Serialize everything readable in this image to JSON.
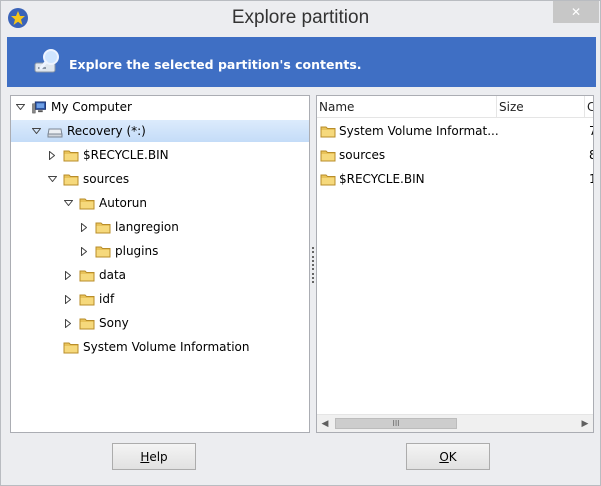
{
  "window": {
    "title": "Explore partition",
    "close_label": "✕"
  },
  "banner": {
    "text": "Explore the selected partition's contents."
  },
  "tree": {
    "root": "My Computer",
    "drive": "Recovery (*:)",
    "items": {
      "recycle": "$RECYCLE.BIN",
      "sources": "sources",
      "autorun": "Autorun",
      "langregion": "langregion",
      "plugins": "plugins",
      "data": "data",
      "idf": "idf",
      "sony": "Sony",
      "svi": "System Volume Information"
    }
  },
  "list": {
    "columns": [
      "Name",
      "Size",
      "C"
    ],
    "rows": [
      {
        "name": "System Volume Informat...",
        "extra": "7"
      },
      {
        "name": "sources",
        "extra": "8"
      },
      {
        "name": "$RECYCLE.BIN",
        "extra": "1"
      }
    ],
    "thumb_grip": "III"
  },
  "buttons": {
    "help_prefix": "",
    "help_hot": "H",
    "help_rest": "elp",
    "ok_hot": "O",
    "ok_rest": "K"
  },
  "colors": {
    "banner": "#3f6fc4",
    "selection": "#c4dcf8",
    "folder": "#e9c35a"
  }
}
